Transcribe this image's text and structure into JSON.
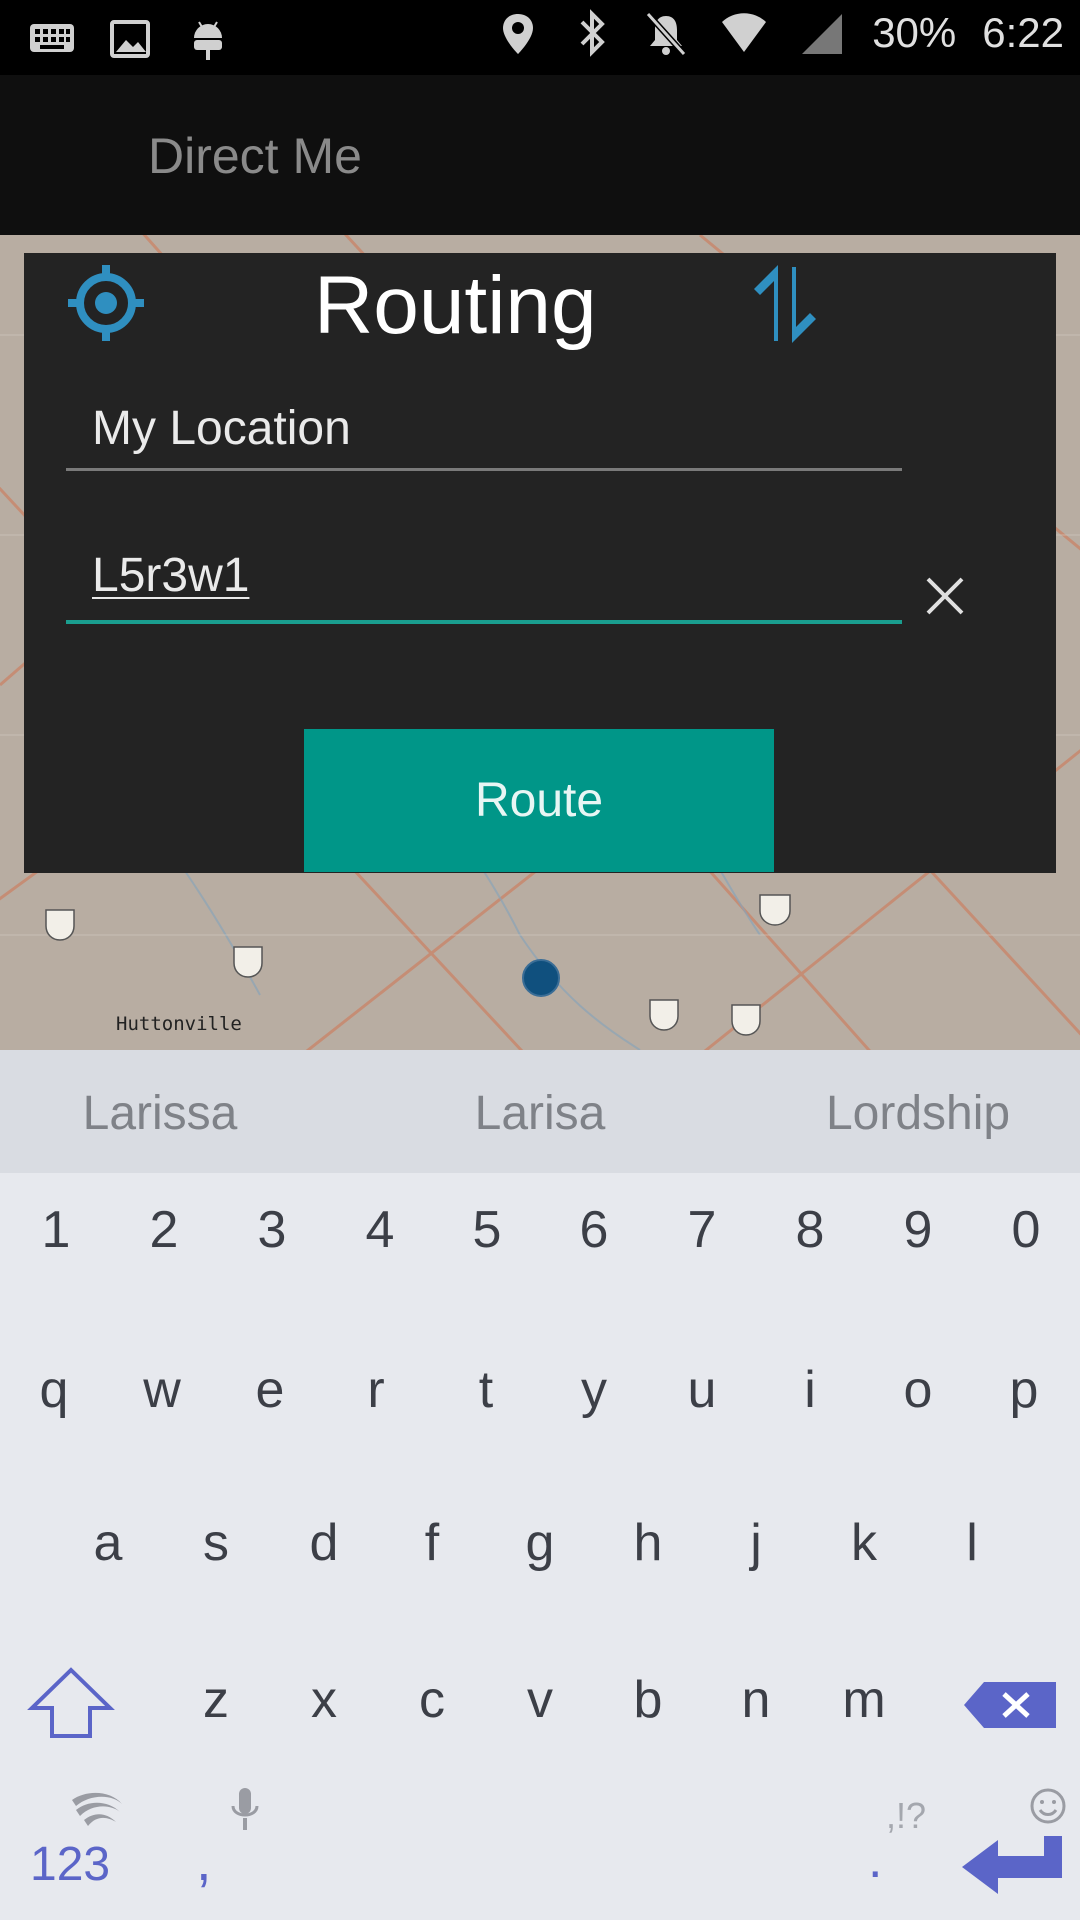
{
  "status_bar": {
    "battery": "30%",
    "time": "6:22",
    "left_icons": [
      "keyboard-icon",
      "image-icon",
      "android-icon"
    ],
    "right_icons": [
      "location-pin-icon",
      "bluetooth-icon",
      "notifications-off-icon",
      "wifi-icon",
      "cell-signal-icon"
    ]
  },
  "app_bar": {
    "title": "Direct Me"
  },
  "map": {
    "place_label": "Huttonville"
  },
  "dialog": {
    "title": "Routing",
    "origin_value": "My Location",
    "destination_value": "L5r3w1",
    "route_label": "Route",
    "accent": "#009688",
    "icon_color": "#2f8fc0"
  },
  "keyboard": {
    "suggestions": [
      "Larissa",
      "Larisa",
      "Lordship"
    ],
    "number_row": [
      "1",
      "2",
      "3",
      "4",
      "5",
      "6",
      "7",
      "8",
      "9",
      "0"
    ],
    "row1": [
      "q",
      "w",
      "e",
      "r",
      "t",
      "y",
      "u",
      "i",
      "o",
      "p"
    ],
    "row2": [
      "a",
      "s",
      "d",
      "f",
      "g",
      "h",
      "j",
      "k",
      "l"
    ],
    "row3": [
      "z",
      "x",
      "c",
      "v",
      "b",
      "n",
      "m"
    ],
    "symbols_label": "123",
    "comma_label": ",",
    "period_label": ".",
    "punct_hint": ",!?",
    "accent": "#5b65c8"
  }
}
